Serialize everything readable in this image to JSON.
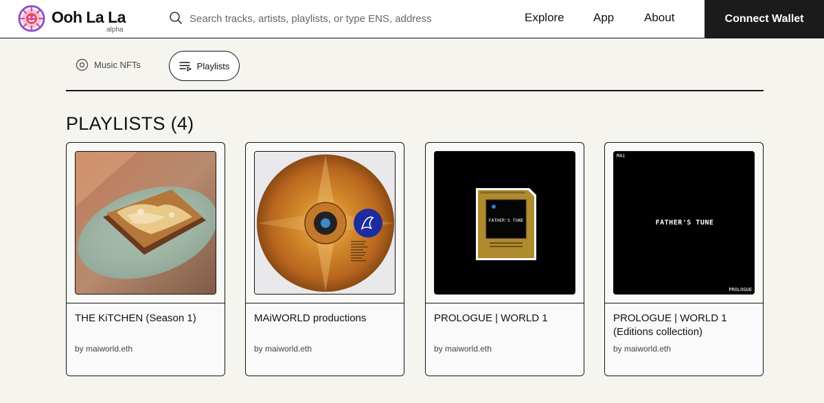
{
  "header": {
    "brand": "Ooh La La",
    "badge": "alpha",
    "search_placeholder": "Search tracks, artists, playlists, or type ENS, address",
    "nav": [
      "Explore",
      "App",
      "About"
    ],
    "connect_label": "Connect Wallet"
  },
  "tabs": {
    "music_nfts": "Music NFTs",
    "playlists": "Playlists"
  },
  "section": {
    "heading": "PLAYLISTS (4)"
  },
  "cards": [
    {
      "title": "THE KiTCHEN (Season 1)",
      "by": "by maiworld.eth"
    },
    {
      "title": "MAiWORLD productions",
      "by": "by maiworld.eth"
    },
    {
      "title": "PROLOGUE | WORLD 1",
      "by": "by maiworld.eth"
    },
    {
      "title": "PROLOGUE | WORLD 1 (Editions collection)",
      "by": "by maiworld.eth"
    }
  ],
  "art": {
    "cartridge_text": "FATHER'S TUNE",
    "poster_text": "FATHER'S TUNE",
    "poster_corner_tl": "MAi",
    "poster_corner_br": "PROLOGUE"
  },
  "colors": {
    "background": "#f5f4ef",
    "header_bg": "#ffffff",
    "connect_bg": "#1b1b1b",
    "logo_pink": "#e8457a",
    "logo_purple": "#8a4fd8"
  },
  "icons": [
    "logo-icon",
    "search-icon",
    "disc-icon",
    "playlist-icon"
  ]
}
